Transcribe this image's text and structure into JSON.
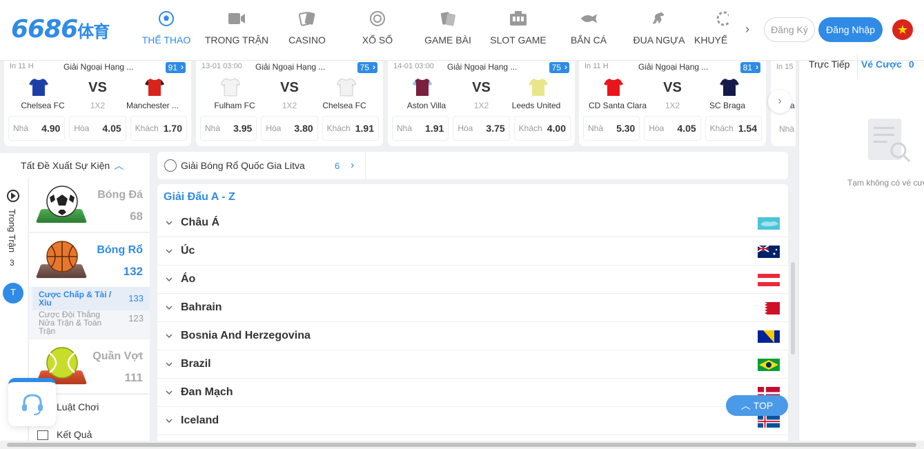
{
  "logo": {
    "text": "6686",
    "suffix": "体育"
  },
  "nav": [
    {
      "label": "THỂ THAO",
      "icon": "soccer-ball-icon"
    },
    {
      "label": "TRONG TRẬN",
      "icon": "video-camera-icon"
    },
    {
      "label": "CASINO",
      "icon": "playing-cards-icon"
    },
    {
      "label": "XỔ SỐ",
      "icon": "lottery-ball-icon"
    },
    {
      "label": "GAME BÀI",
      "icon": "card-game-icon"
    },
    {
      "label": "SLOT GAME",
      "icon": "slot-machine-icon"
    },
    {
      "label": "BẮN CÁ",
      "icon": "fish-icon"
    },
    {
      "label": "ĐUA NGỰA",
      "icon": "horse-icon"
    },
    {
      "label": "KHUYẾ",
      "icon": "gift-icon"
    }
  ],
  "auth": {
    "register": "Đăng Ký",
    "login": "Đăng Nhập"
  },
  "colors": {
    "accent": "#2f8be6"
  },
  "matches": [
    {
      "time": "In 11 H",
      "league": "Giải Ngoại Hạng ...",
      "count": "91",
      "home": "Chelsea FC",
      "away": "Manchester ...",
      "market": "1X2",
      "vs": "VS",
      "odds": [
        {
          "label": "Nhà",
          "value": "4.90"
        },
        {
          "label": "Hòa",
          "value": "4.05"
        },
        {
          "label": "Khách",
          "value": "1.70"
        }
      ]
    },
    {
      "time": "13-01 03:00",
      "league": "Giải Ngoại Hạng ...",
      "count": "75",
      "home": "Fulham FC",
      "away": "Chelsea FC",
      "market": "1X2",
      "vs": "VS",
      "odds": [
        {
          "label": "Nhà",
          "value": "3.95"
        },
        {
          "label": "Hòa",
          "value": "3.80"
        },
        {
          "label": "Khách",
          "value": "1.91"
        }
      ]
    },
    {
      "time": "14-01 03:00",
      "league": "Giải Ngoại Hạng ...",
      "count": "75",
      "home": "Aston Villa",
      "away": "Leeds United",
      "market": "1X2",
      "vs": "VS",
      "odds": [
        {
          "label": "Nhà",
          "value": "1.91"
        },
        {
          "label": "Hòa",
          "value": "3.75"
        },
        {
          "label": "Khách",
          "value": "4.00"
        }
      ]
    },
    {
      "time": "In 11 H",
      "league": "Giải Ngoại Hạng ...",
      "count": "81",
      "home": "CD Santa Clara",
      "away": "SC Braga",
      "market": "1X2",
      "vs": "VS",
      "odds": [
        {
          "label": "Nhà",
          "value": "5.30"
        },
        {
          "label": "Hòa",
          "value": "4.05"
        },
        {
          "label": "Khách",
          "value": "1.54"
        }
      ]
    }
  ],
  "partial_card": {
    "time": "In 15",
    "team": "Orla",
    "odd_label": "Nhà"
  },
  "sidebar": {
    "header": "Tất Đề Xuất Sự Kiện",
    "live_label": "Trong Trận",
    "live_count": "3",
    "live_badge": "T",
    "sports": [
      {
        "name": "Bóng Đá",
        "count": "68"
      },
      {
        "name": "Bóng Rổ",
        "count": "132"
      },
      {
        "name": "Quần Vợt",
        "count": "111"
      }
    ],
    "subitems": [
      {
        "label": "Cược Chấp & Tài / Xỉu",
        "count": "133"
      },
      {
        "label": "Cược Đội Thắng Nửa Trận & Toàn Trận",
        "count": "123"
      }
    ],
    "misc": [
      {
        "label": "Luật Chơi"
      },
      {
        "label": "Kết Quả"
      }
    ]
  },
  "filter": {
    "label": "Giải Bóng Rổ Quốc Gia Litva",
    "count": "6"
  },
  "leagues_title": "Giải Đấu A - Z",
  "regions": [
    "Châu Á",
    "Úc",
    "Áo",
    "Bahrain",
    "Bosnia And Herzegovina",
    "Brazil",
    "Đan Mạch",
    "Iceland"
  ],
  "top_button": "TOP",
  "right_panel": {
    "tab_live": "Trực Tiếp",
    "tab_tickets": "Vé Cược",
    "tickets_count": "0",
    "empty_text": "Tạm không có vé cược"
  }
}
